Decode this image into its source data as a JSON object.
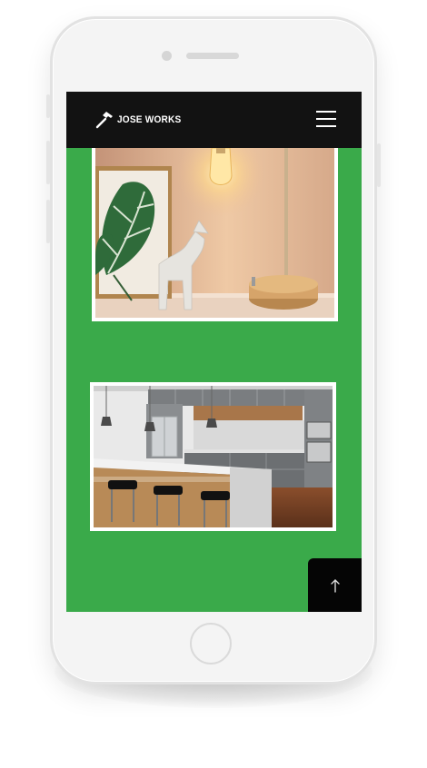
{
  "app": {
    "brand_name": "JOSE WORKS",
    "brand_icon": "hammer-icon",
    "menu_icon": "hamburger-menu-icon",
    "scroll_top_icon": "arrow-up-icon"
  },
  "colors": {
    "page_background": "#3aaa4a",
    "navbar": "#121212",
    "scroll_top_button": "#050505",
    "photo_frame": "#ffffff"
  },
  "gallery": {
    "items": [
      {
        "subject": "table-lamp-and-plant-artwork-photo"
      },
      {
        "subject": "modern-kitchen-with-island-photo"
      }
    ]
  }
}
